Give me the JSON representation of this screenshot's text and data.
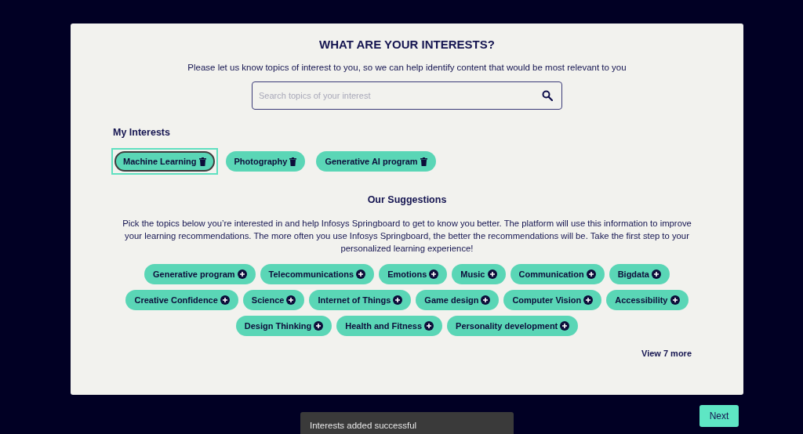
{
  "title": "WHAT ARE YOUR INTERESTS?",
  "intro": "Please let us know topics of interest to you, so we can help identify content that would be most relevant to you",
  "search": {
    "placeholder": "Search topics of your interest"
  },
  "my_interests": {
    "heading": "My Interests",
    "items": [
      {
        "label": "Machine Learning",
        "focused": true
      },
      {
        "label": "Photography",
        "focused": false
      },
      {
        "label": "Generative AI program",
        "focused": false
      }
    ]
  },
  "suggestions": {
    "heading": "Our Suggestions",
    "description": "Pick the topics below you’re interested in and help Infosys Springboard to get to know you better. The platform will use this information to improve your learning recommendations. The more often you use Infosys Springboard, the better the recommendations will be. Take the first step to your personalized learning experience!",
    "items": [
      "Generative program",
      "Telecommunications",
      "Emotions",
      "Music",
      "Communication",
      "Bigdata",
      "Creative Confidence",
      "Science",
      "Internet of Things",
      "Game design",
      "Computer Vision",
      "Accessibility",
      "Design Thinking",
      "Health and Fitness",
      "Personality development"
    ],
    "view_more": "View 7 more"
  },
  "next_button": "Next",
  "toast": "Interests added successful"
}
